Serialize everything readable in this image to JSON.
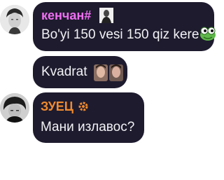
{
  "messages": [
    {
      "author": "кенчан#",
      "author_color": "#ef6ff2",
      "text": "Bo'yi 150 vesi 150 qiz kere",
      "emotes": [
        "photo-badge-icon",
        "frog-emote"
      ]
    },
    {
      "text": "Kvadrat",
      "emotes": [
        "faces-emote"
      ]
    },
    {
      "author": "ЗУЕЦ",
      "author_color": "#f08a2e",
      "text": "Мани излавос?",
      "emotes": [
        "gear-icon"
      ]
    }
  ],
  "colors": {
    "bubble": "#1e1b2e",
    "text": "#f2f2f5",
    "background": "#ffffff"
  }
}
